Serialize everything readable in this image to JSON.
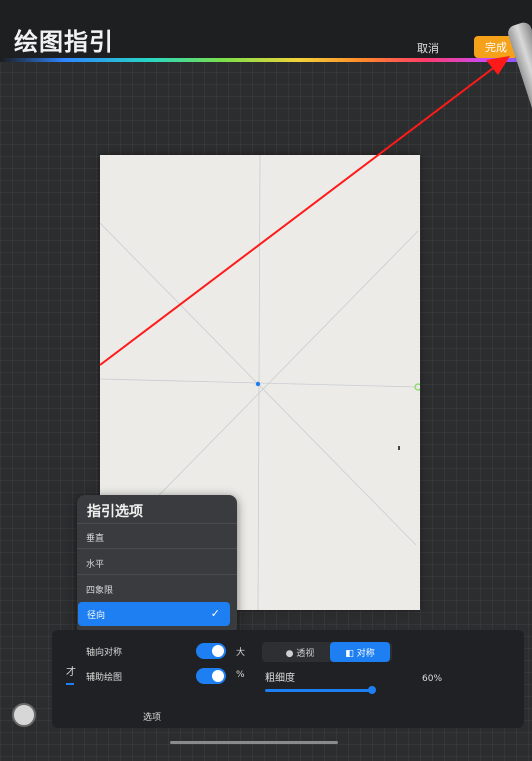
{
  "header": {
    "title": "绘图指引",
    "cancel_label": "取消",
    "done_label": "完成"
  },
  "popup": {
    "title": "指引选项",
    "items": [
      {
        "label": "垂直",
        "selected": false
      },
      {
        "label": "水平",
        "selected": false
      },
      {
        "label": "四象限",
        "selected": false
      },
      {
        "label": "径向",
        "selected": true
      }
    ],
    "check_glyph": "✓"
  },
  "panel": {
    "axial_symmetry_label": "轴向对称",
    "assisted_drawing_label": "辅助绘图",
    "size_prefix": "大",
    "percent_prefix": "%",
    "side_glyph": "才",
    "segment": {
      "perspective_label": "透视",
      "symmetry_label": "对称",
      "active": "symmetry"
    },
    "thickness_label": "粗细度",
    "thickness_value": "60%",
    "thickness_level": 0.6,
    "options_label": "选项"
  },
  "colors": {
    "accent": "#1d7ff2",
    "done_button": "#f5a11a",
    "annotation_arrow": "#ff1a1a"
  }
}
